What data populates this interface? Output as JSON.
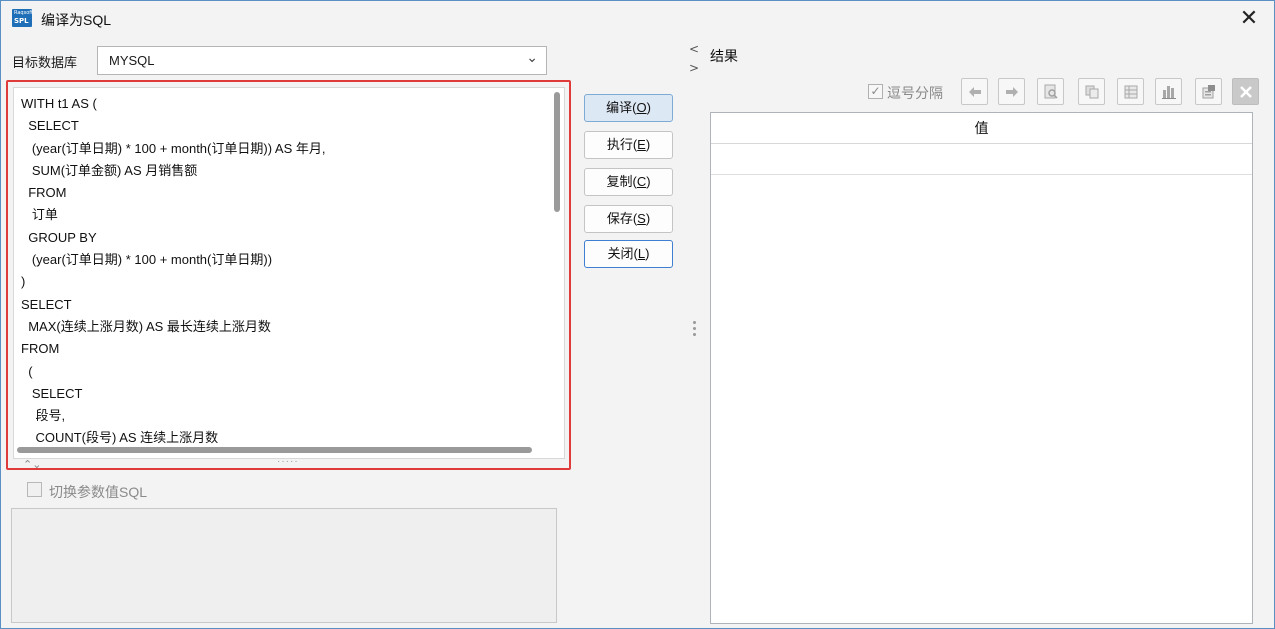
{
  "window": {
    "title": "编译为SQL",
    "icon_top": "Raqsoft",
    "icon_bottom": "SPL",
    "close_glyph": "✕"
  },
  "left": {
    "db_label": "目标数据库",
    "db_value": "MYSQL",
    "code_lines": [
      "WITH t1 AS (",
      "  SELECT",
      "   (year(订单日期) * 100 + month(订单日期)) AS 年月,",
      "   SUM(订单金额) AS 月销售额",
      "  FROM",
      "   订单",
      "  GROUP BY",
      "   (year(订单日期) * 100 + month(订单日期))",
      ")",
      "SELECT",
      "  MAX(连续上涨月数) AS 最长连续上涨月数",
      "FROM",
      "  (",
      "   SELECT",
      "    段号,",
      "    COUNT(段号) AS 连续上涨月数"
    ],
    "param_checkbox_label": "切换参数值SQL",
    "split_arrows": "⌃⌄",
    "split_dots": "·····"
  },
  "buttons": [
    {
      "text": "编译",
      "key": "O"
    },
    {
      "text": "执行",
      "key": "E"
    },
    {
      "text": "复制",
      "key": "C"
    },
    {
      "text": "保存",
      "key": "S"
    },
    {
      "text": "关闭",
      "key": "L"
    }
  ],
  "right": {
    "title": "结果",
    "collapse_left": "<",
    "collapse_right": ">",
    "comma_checkbox_label": "逗号分隔",
    "comma_checked": true,
    "comma_check_glyph": "✓",
    "toolbar_icons": [
      "arrow-left-icon",
      "arrow-right-icon",
      "preview-icon",
      "copy-icon",
      "table-icon",
      "chart-icon",
      "export-icon",
      "close-icon"
    ],
    "table_header": "值"
  },
  "colors": {
    "highlight_border": "#e03b3b",
    "primary_button_bg": "#dde8f5",
    "window_border": "#5a8fc4"
  }
}
